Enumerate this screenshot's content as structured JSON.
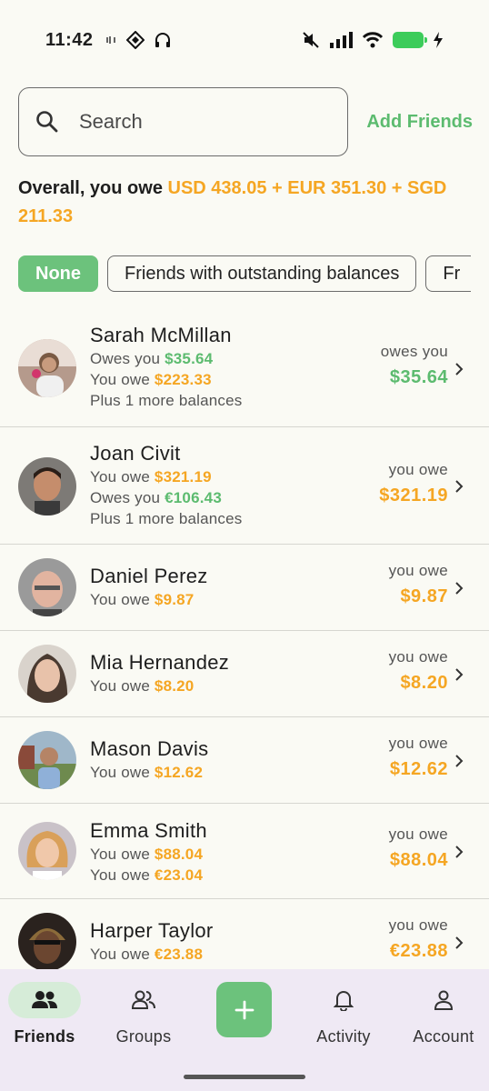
{
  "status": {
    "time": "11:42"
  },
  "search": {
    "placeholder": "Search",
    "add_friends": "Add Friends"
  },
  "overall": {
    "prefix": "Overall, you owe ",
    "amounts": "USD 438.05 + EUR 351.30 + SGD 211.33"
  },
  "chips": [
    "None",
    "Friends with outstanding balances",
    "Fr"
  ],
  "friends": [
    {
      "name": "Sarah McMillan",
      "lines": [
        [
          "Owes you ",
          "$35.64",
          "g"
        ],
        [
          "You owe ",
          "$223.33",
          "o"
        ],
        [
          "Plus 1 more balances",
          "",
          ""
        ]
      ],
      "status": "owes you",
      "amount": "$35.64",
      "color": "g"
    },
    {
      "name": "Joan Civit",
      "lines": [
        [
          "You owe ",
          "$321.19",
          "o"
        ],
        [
          "Owes you ",
          "€106.43",
          "g"
        ],
        [
          "Plus 1 more balances",
          "",
          ""
        ]
      ],
      "status": "you owe",
      "amount": "$321.19",
      "color": "o"
    },
    {
      "name": "Daniel Perez",
      "lines": [
        [
          "You owe ",
          "$9.87",
          "o"
        ]
      ],
      "status": "you owe",
      "amount": "$9.87",
      "color": "o"
    },
    {
      "name": "Mia Hernandez",
      "lines": [
        [
          "You owe ",
          "$8.20",
          "o"
        ]
      ],
      "status": "you owe",
      "amount": "$8.20",
      "color": "o"
    },
    {
      "name": "Mason Davis",
      "lines": [
        [
          "You owe ",
          "$12.62",
          "o"
        ]
      ],
      "status": "you owe",
      "amount": "$12.62",
      "color": "o"
    },
    {
      "name": "Emma Smith",
      "lines": [
        [
          "You owe ",
          "$88.04",
          "o"
        ],
        [
          "You owe ",
          "€23.04",
          "o"
        ]
      ],
      "status": "you owe",
      "amount": "$88.04",
      "color": "o"
    },
    {
      "name": "Harper Taylor",
      "lines": [
        [
          "You owe ",
          "€23.88",
          "o"
        ]
      ],
      "status": "you owe",
      "amount": "€23.88",
      "color": "o"
    }
  ],
  "nav": {
    "friends": "Friends",
    "groups": "Groups",
    "activity": "Activity",
    "account": "Account"
  },
  "colors": {
    "accent": "#6cc27c",
    "positive": "#5cbb6f",
    "owe": "#f5a623",
    "nav_bg": "#efe9f4"
  }
}
